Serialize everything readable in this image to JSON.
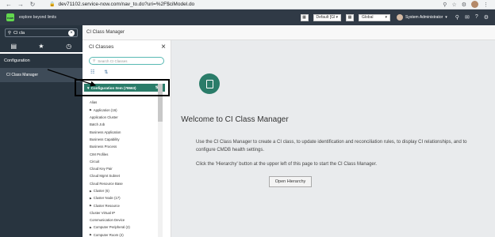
{
  "browser": {
    "url": "dev71102.service-now.com/nav_to.do?uri=%2F$ciModel.do",
    "icons": [
      "back-icon",
      "forward-icon",
      "reload-icon",
      "lock-icon",
      "zoom-icon",
      "star-icon",
      "extension-icon",
      "profile-icon",
      "menu-icon"
    ]
  },
  "header": {
    "logo_text": "now",
    "tagline": "explore beyond limits",
    "update_set": "Default [Gl",
    "scope": "Global",
    "user": "System Administrator",
    "icons": [
      "search-icon",
      "connect-icon",
      "help-icon",
      "settings-icon"
    ]
  },
  "leftnav": {
    "filter_value": "CI cla",
    "tabs": [
      "all-apps-tab",
      "favorites-tab",
      "history-tab"
    ],
    "group": "Configuration",
    "item": "CI Class Manager"
  },
  "content": {
    "title": "CI Class Manager"
  },
  "ci_panel": {
    "title": "CI Classes",
    "search_placeholder": "Search CI Classes",
    "selected_class": "Configuration Item (78663)",
    "classes": [
      {
        "label": "Alias",
        "expandable": false
      },
      {
        "label": "Application (16)",
        "expandable": true
      },
      {
        "label": "Application Cluster",
        "expandable": false
      },
      {
        "label": "Batch Job",
        "expandable": false
      },
      {
        "label": "Business Application",
        "expandable": false
      },
      {
        "label": "Business Capability",
        "expandable": false
      },
      {
        "label": "Business Process",
        "expandable": false
      },
      {
        "label": "CIM Profiles",
        "expandable": false
      },
      {
        "label": "Circuit",
        "expandable": false
      },
      {
        "label": "Cloud Key Pair",
        "expandable": false
      },
      {
        "label": "Cloud Mgmt Subnet",
        "expandable": false
      },
      {
        "label": "Cloud Resource Base",
        "expandable": false
      },
      {
        "label": "Cluster (6)",
        "expandable": true
      },
      {
        "label": "Cluster Node (17)",
        "expandable": true
      },
      {
        "label": "Cluster Resource",
        "expandable": true
      },
      {
        "label": "Cluster Virtual IP",
        "expandable": false
      },
      {
        "label": "Communication Device",
        "expandable": false
      },
      {
        "label": "Computer Peripheral (2)",
        "expandable": true
      },
      {
        "label": "Computer Room (2)",
        "expandable": true
      }
    ]
  },
  "welcome": {
    "title": "Welcome to CI Class Manager",
    "paragraph1": "Use the CI Class Manager to create a CI class, to update identification and reconciliation rules, to display CI relationships, and to configure CMDB health settings.",
    "paragraph2": "Click the 'Hierarchy' button at the upper left of this page to start the CI Class Manager.",
    "button": "Open Hierarchy"
  },
  "colors": {
    "header_bg": "#303a46",
    "nav_bg": "#28343f",
    "accent": "#2a7c69",
    "search_border": "#58b9b3"
  }
}
